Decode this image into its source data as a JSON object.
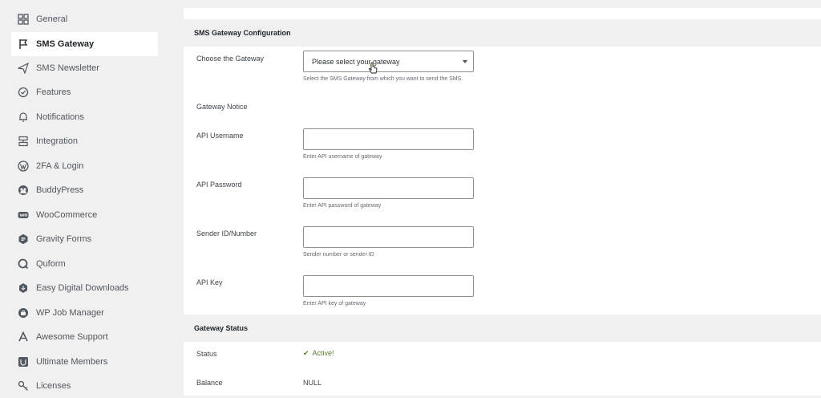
{
  "sidebar": {
    "items": [
      {
        "label": "General",
        "icon": "grid-icon"
      },
      {
        "label": "SMS Gateway",
        "icon": "flag-icon",
        "active": true
      },
      {
        "label": "SMS Newsletter",
        "icon": "send-icon"
      },
      {
        "label": "Features",
        "icon": "check-circle-icon"
      },
      {
        "label": "Notifications",
        "icon": "bell-icon"
      },
      {
        "label": "Integration",
        "icon": "integration-icon"
      },
      {
        "label": "2FA & Login",
        "icon": "wordpress-icon"
      },
      {
        "label": "BuddyPress",
        "icon": "buddypress-icon"
      },
      {
        "label": "WooCommerce",
        "icon": "woocommerce-icon"
      },
      {
        "label": "Gravity Forms",
        "icon": "gravity-forms-icon"
      },
      {
        "label": "Quform",
        "icon": "quform-icon"
      },
      {
        "label": "Easy Digital Downloads",
        "icon": "edd-icon"
      },
      {
        "label": "WP Job Manager",
        "icon": "job-manager-icon"
      },
      {
        "label": "Awesome Support",
        "icon": "awesome-support-icon"
      },
      {
        "label": "Ultimate Members",
        "icon": "ultimate-member-icon"
      },
      {
        "label": "Licenses",
        "icon": "key-icon"
      }
    ]
  },
  "config": {
    "section_title": "SMS Gateway Configuration",
    "gateway": {
      "label": "Choose the Gateway",
      "selected": "Please select your gateway",
      "hint": "Select the SMS Gateway from which you want to send the SMS."
    },
    "notice": {
      "label": "Gateway Notice"
    },
    "username": {
      "label": "API Username",
      "value": "",
      "hint": "Enter API username of gateway"
    },
    "password": {
      "label": "API Password",
      "value": "",
      "hint": "Enter API password of gateway"
    },
    "sender": {
      "label": "Sender ID/Number",
      "value": "",
      "hint": "Sender number or sender ID"
    },
    "apikey": {
      "label": "API Key",
      "value": "",
      "hint": "Enter API key of gateway"
    }
  },
  "status": {
    "section_title": "Gateway Status",
    "status_label": "Status",
    "status_value": "Active!",
    "balance_label": "Balance",
    "balance_value": "NULL"
  },
  "colors": {
    "active_status": "#5b7a2d",
    "background": "#f0f0f1",
    "panel": "#ffffff"
  }
}
